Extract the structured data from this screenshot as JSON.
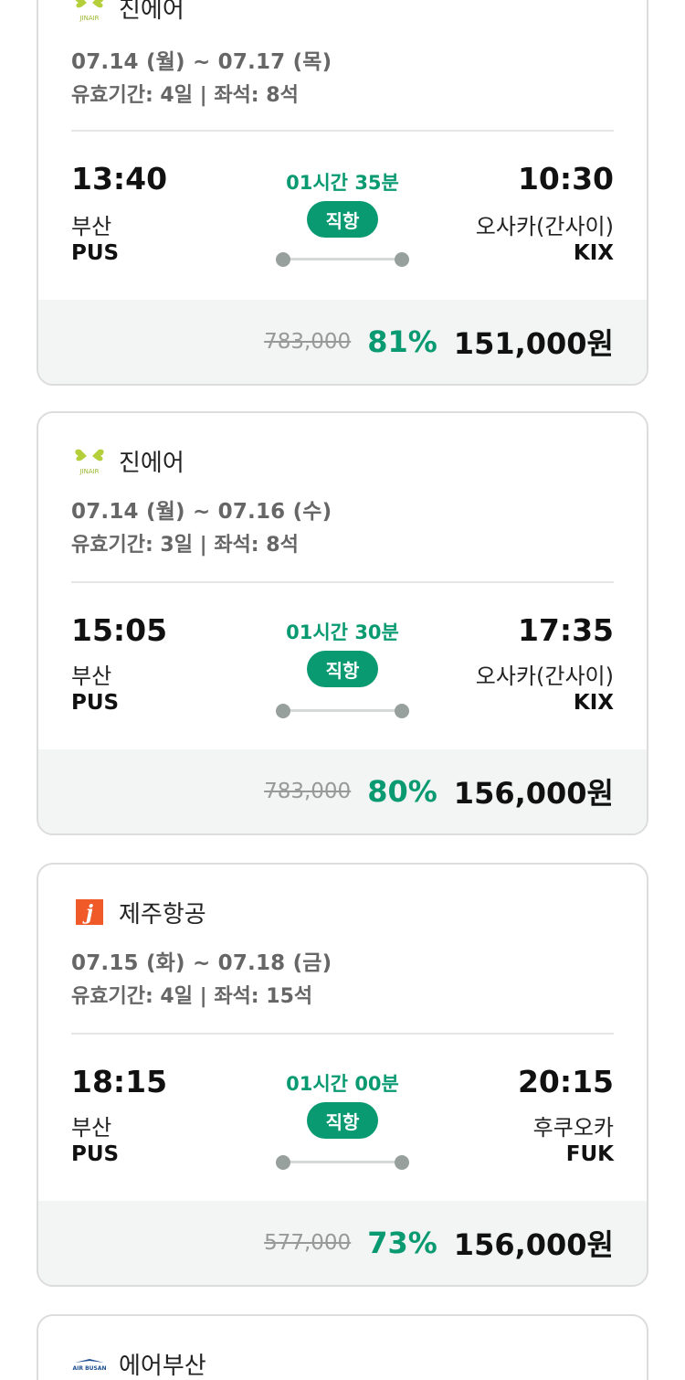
{
  "colors": {
    "accent": "#0a9a72",
    "strike": "#999999",
    "panel": "#f3f4f4",
    "border": "#dcdcdc"
  },
  "flights": [
    {
      "airline": {
        "name": "진에어",
        "logo_icon": "jinair-butterfly-logo"
      },
      "dates": "07.14 (월) ~ 07.17 (목)",
      "meta": "유효기간: 4일 | 좌석: 8석",
      "departure": {
        "time": "13:40",
        "city": "부산",
        "code": "PUS"
      },
      "arrival": {
        "time": "10:30",
        "city": "오사카(간사이)",
        "code": "KIX"
      },
      "duration": "01시간 35분",
      "type": "직항",
      "original_price": "783,000",
      "discount": "81%",
      "price": "151,000원"
    },
    {
      "airline": {
        "name": "진에어",
        "logo_icon": "jinair-butterfly-logo"
      },
      "dates": "07.14 (월) ~ 07.16 (수)",
      "meta": "유효기간: 3일 | 좌석: 8석",
      "departure": {
        "time": "15:05",
        "city": "부산",
        "code": "PUS"
      },
      "arrival": {
        "time": "17:35",
        "city": "오사카(간사이)",
        "code": "KIX"
      },
      "duration": "01시간 30분",
      "type": "직항",
      "original_price": "783,000",
      "discount": "80%",
      "price": "156,000원"
    },
    {
      "airline": {
        "name": "제주항공",
        "logo_icon": "jejuair-logo"
      },
      "dates": "07.15 (화) ~ 07.18 (금)",
      "meta": "유효기간: 4일 | 좌석: 15석",
      "departure": {
        "time": "18:15",
        "city": "부산",
        "code": "PUS"
      },
      "arrival": {
        "time": "20:15",
        "city": "후쿠오카",
        "code": "FUK"
      },
      "duration": "01시간 00분",
      "type": "직항",
      "original_price": "577,000",
      "discount": "73%",
      "price": "156,000원"
    },
    {
      "airline": {
        "name": "에어부산",
        "logo_icon": "airbusan-logo"
      }
    }
  ]
}
